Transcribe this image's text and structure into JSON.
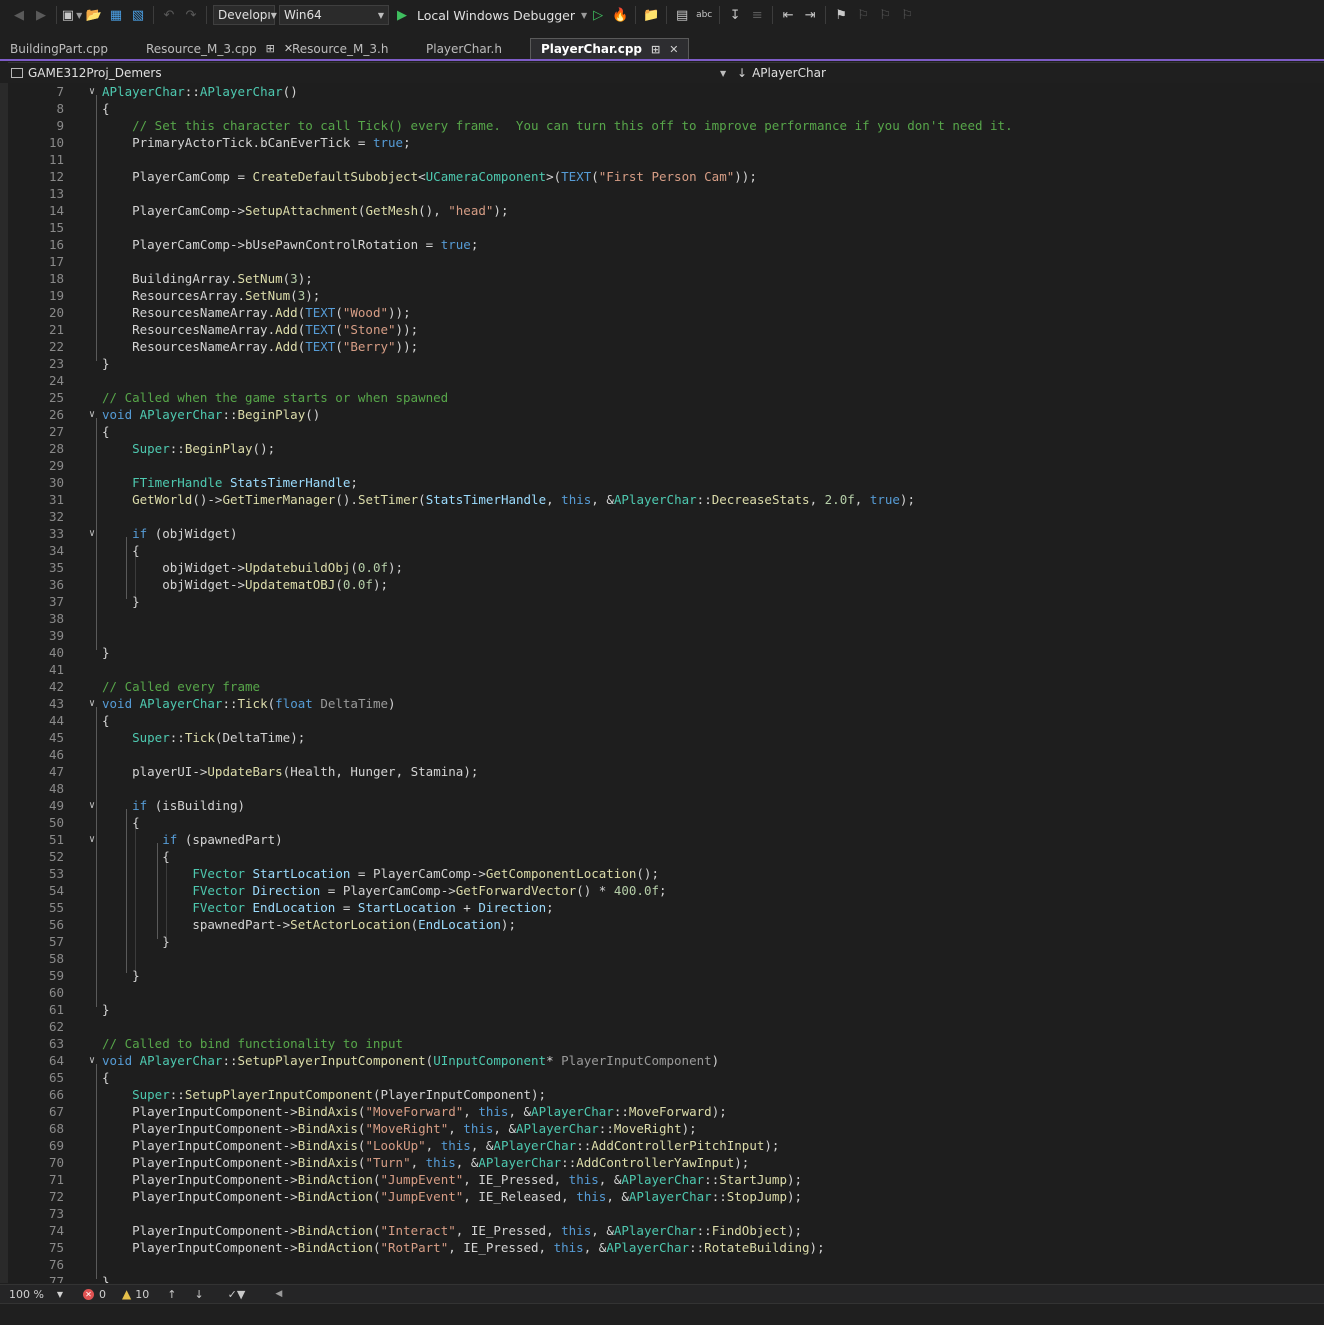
{
  "toolbar": {
    "configuration": "Developı",
    "platform": "Win64",
    "debugger": "Local Windows Debugger"
  },
  "tabs": [
    {
      "label": "BuildingPart.cpp",
      "active": false
    },
    {
      "label": "Resource_M_3.cpp",
      "active": false
    },
    {
      "label": "Resource_M_3.h",
      "active": false
    },
    {
      "label": "PlayerChar.h",
      "active": false
    },
    {
      "label": "PlayerChar.cpp",
      "active": true
    }
  ],
  "navbar": {
    "project": "GAME312Proj_Demers",
    "scope": "APlayerChar"
  },
  "code": {
    "lines": [
      {
        "n": "7",
        "text": "APlayerChar::APlayerChar()"
      },
      {
        "n": "8",
        "text": "{"
      },
      {
        "n": "9",
        "text": "    // Set this character to call Tick() every frame.  You can turn this off to improve performance if you don't need it."
      },
      {
        "n": "10",
        "text": "    PrimaryActorTick.bCanEverTick = true;"
      },
      {
        "n": "11",
        "text": ""
      },
      {
        "n": "12",
        "text": "    PlayerCamComp = CreateDefaultSubobject<UCameraComponent>(TEXT(\"First Person Cam\"));"
      },
      {
        "n": "13",
        "text": ""
      },
      {
        "n": "14",
        "text": "    PlayerCamComp->SetupAttachment(GetMesh(), \"head\");"
      },
      {
        "n": "15",
        "text": ""
      },
      {
        "n": "16",
        "text": "    PlayerCamComp->bUsePawnControlRotation = true;"
      },
      {
        "n": "17",
        "text": ""
      },
      {
        "n": "18",
        "text": "    BuildingArray.SetNum(3);"
      },
      {
        "n": "19",
        "text": "    ResourcesArray.SetNum(3);"
      },
      {
        "n": "20",
        "text": "    ResourcesNameArray.Add(TEXT(\"Wood\"));"
      },
      {
        "n": "21",
        "text": "    ResourcesNameArray.Add(TEXT(\"Stone\"));"
      },
      {
        "n": "22",
        "text": "    ResourcesNameArray.Add(TEXT(\"Berry\"));"
      },
      {
        "n": "23",
        "text": "}"
      },
      {
        "n": "24",
        "text": ""
      },
      {
        "n": "25",
        "text": "// Called when the game starts or when spawned"
      },
      {
        "n": "26",
        "text": "void APlayerChar::BeginPlay()"
      },
      {
        "n": "27",
        "text": "{"
      },
      {
        "n": "28",
        "text": "    Super::BeginPlay();"
      },
      {
        "n": "29",
        "text": ""
      },
      {
        "n": "30",
        "text": "    FTimerHandle StatsTimerHandle;"
      },
      {
        "n": "31",
        "text": "    GetWorld()->GetTimerManager().SetTimer(StatsTimerHandle, this, &APlayerChar::DecreaseStats, 2.0f, true);"
      },
      {
        "n": "32",
        "text": ""
      },
      {
        "n": "33",
        "text": "    if (objWidget)"
      },
      {
        "n": "34",
        "text": "    {"
      },
      {
        "n": "35",
        "text": "        objWidget->UpdatebuildObj(0.0f);"
      },
      {
        "n": "36",
        "text": "        objWidget->UpdatematOBJ(0.0f);"
      },
      {
        "n": "37",
        "text": "    }"
      },
      {
        "n": "38",
        "text": ""
      },
      {
        "n": "39",
        "text": ""
      },
      {
        "n": "40",
        "text": "}"
      },
      {
        "n": "41",
        "text": ""
      },
      {
        "n": "42",
        "text": "// Called every frame"
      },
      {
        "n": "43",
        "text": "void APlayerChar::Tick(float DeltaTime)"
      },
      {
        "n": "44",
        "text": "{"
      },
      {
        "n": "45",
        "text": "    Super::Tick(DeltaTime);"
      },
      {
        "n": "46",
        "text": ""
      },
      {
        "n": "47",
        "text": "    playerUI->UpdateBars(Health, Hunger, Stamina);"
      },
      {
        "n": "48",
        "text": ""
      },
      {
        "n": "49",
        "text": "    if (isBuilding)"
      },
      {
        "n": "50",
        "text": "    {"
      },
      {
        "n": "51",
        "text": "        if (spawnedPart)"
      },
      {
        "n": "52",
        "text": "        {"
      },
      {
        "n": "53",
        "text": "            FVector StartLocation = PlayerCamComp->GetComponentLocation();"
      },
      {
        "n": "54",
        "text": "            FVector Direction = PlayerCamComp->GetForwardVector() * 400.0f;"
      },
      {
        "n": "55",
        "text": "            FVector EndLocation = StartLocation + Direction;"
      },
      {
        "n": "56",
        "text": "            spawnedPart->SetActorLocation(EndLocation);"
      },
      {
        "n": "57",
        "text": "        }"
      },
      {
        "n": "58",
        "text": ""
      },
      {
        "n": "59",
        "text": "    }"
      },
      {
        "n": "60",
        "text": ""
      },
      {
        "n": "61",
        "text": "}"
      },
      {
        "n": "62",
        "text": ""
      },
      {
        "n": "63",
        "text": "// Called to bind functionality to input"
      },
      {
        "n": "64",
        "text": "void APlayerChar::SetupPlayerInputComponent(UInputComponent* PlayerInputComponent)"
      },
      {
        "n": "65",
        "text": "{"
      },
      {
        "n": "66",
        "text": "    Super::SetupPlayerInputComponent(PlayerInputComponent);"
      },
      {
        "n": "67",
        "text": "    PlayerInputComponent->BindAxis(\"MoveForward\", this, &APlayerChar::MoveForward);"
      },
      {
        "n": "68",
        "text": "    PlayerInputComponent->BindAxis(\"MoveRight\", this, &APlayerChar::MoveRight);"
      },
      {
        "n": "69",
        "text": "    PlayerInputComponent->BindAxis(\"LookUp\", this, &APlayerChar::AddControllerPitchInput);"
      },
      {
        "n": "70",
        "text": "    PlayerInputComponent->BindAxis(\"Turn\", this, &APlayerChar::AddControllerYawInput);"
      },
      {
        "n": "71",
        "text": "    PlayerInputComponent->BindAction(\"JumpEvent\", IE_Pressed, this, &APlayerChar::StartJump);"
      },
      {
        "n": "72",
        "text": "    PlayerInputComponent->BindAction(\"JumpEvent\", IE_Released, this, &APlayerChar::StopJump);"
      },
      {
        "n": "73",
        "text": ""
      },
      {
        "n": "74",
        "text": "    PlayerInputComponent->BindAction(\"Interact\", IE_Pressed, this, &APlayerChar::FindObject);"
      },
      {
        "n": "75",
        "text": "    PlayerInputComponent->BindAction(\"RotPart\", IE_Pressed, this, &APlayerChar::RotateBuilding);"
      },
      {
        "n": "76",
        "text": ""
      },
      {
        "n": "77",
        "text": "}"
      }
    ]
  },
  "status": {
    "zoom": "100 %",
    "errors": "0",
    "warnings": "10"
  },
  "colors": {
    "keyword": "#569cd6",
    "type": "#4ec9b0",
    "function": "#dcdcaa",
    "string": "#d69d85",
    "comment": "#57a64a",
    "number": "#b5cea8",
    "active_tab_accent": "#7e5cc7"
  }
}
